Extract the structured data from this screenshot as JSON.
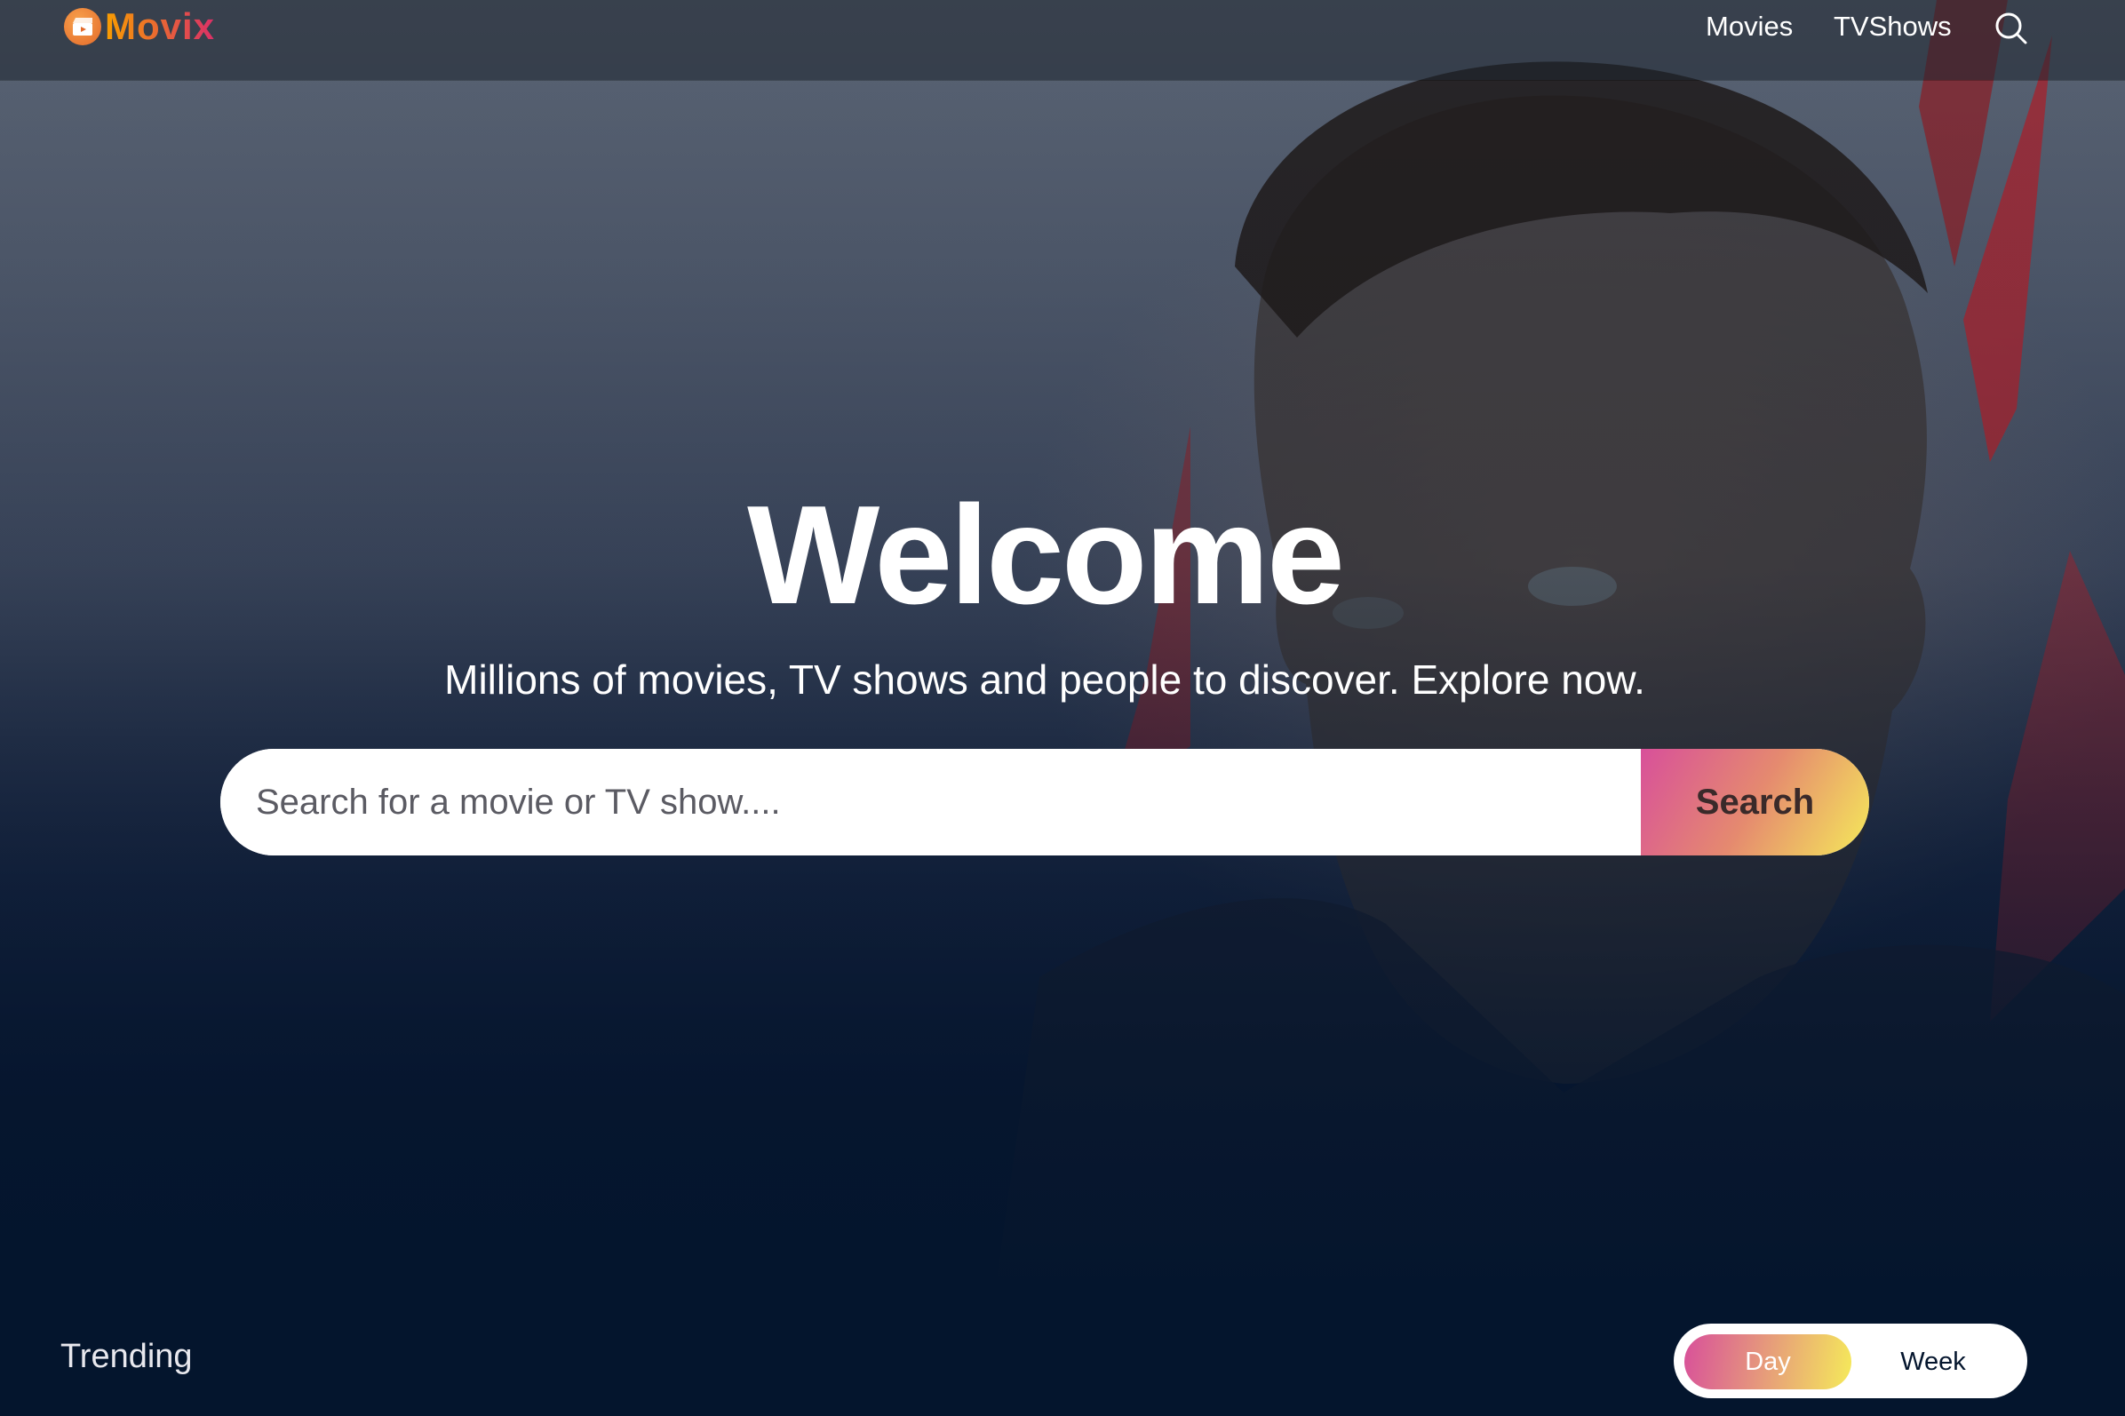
{
  "header": {
    "logo_text": "Movix",
    "nav": [
      {
        "label": "Movies"
      },
      {
        "label": "TVShows"
      }
    ]
  },
  "hero": {
    "title": "Welcome",
    "subtitle": "Millions of movies, TV shows and people to discover. Explore now.",
    "search": {
      "placeholder": "Search for a movie or TV show....",
      "button_label": "Search"
    }
  },
  "trending": {
    "title": "Trending",
    "tabs": [
      {
        "label": "Day",
        "active": true
      },
      {
        "label": "Week",
        "active": false
      }
    ]
  },
  "colors": {
    "background": "#04152d",
    "brand_gradient_start": "#f89e00",
    "brand_gradient_end": "#da2f68",
    "search_button_gradient": [
      "#d8509a",
      "#f5ea5a"
    ]
  },
  "icons": [
    "logo-icon",
    "search-icon"
  ]
}
